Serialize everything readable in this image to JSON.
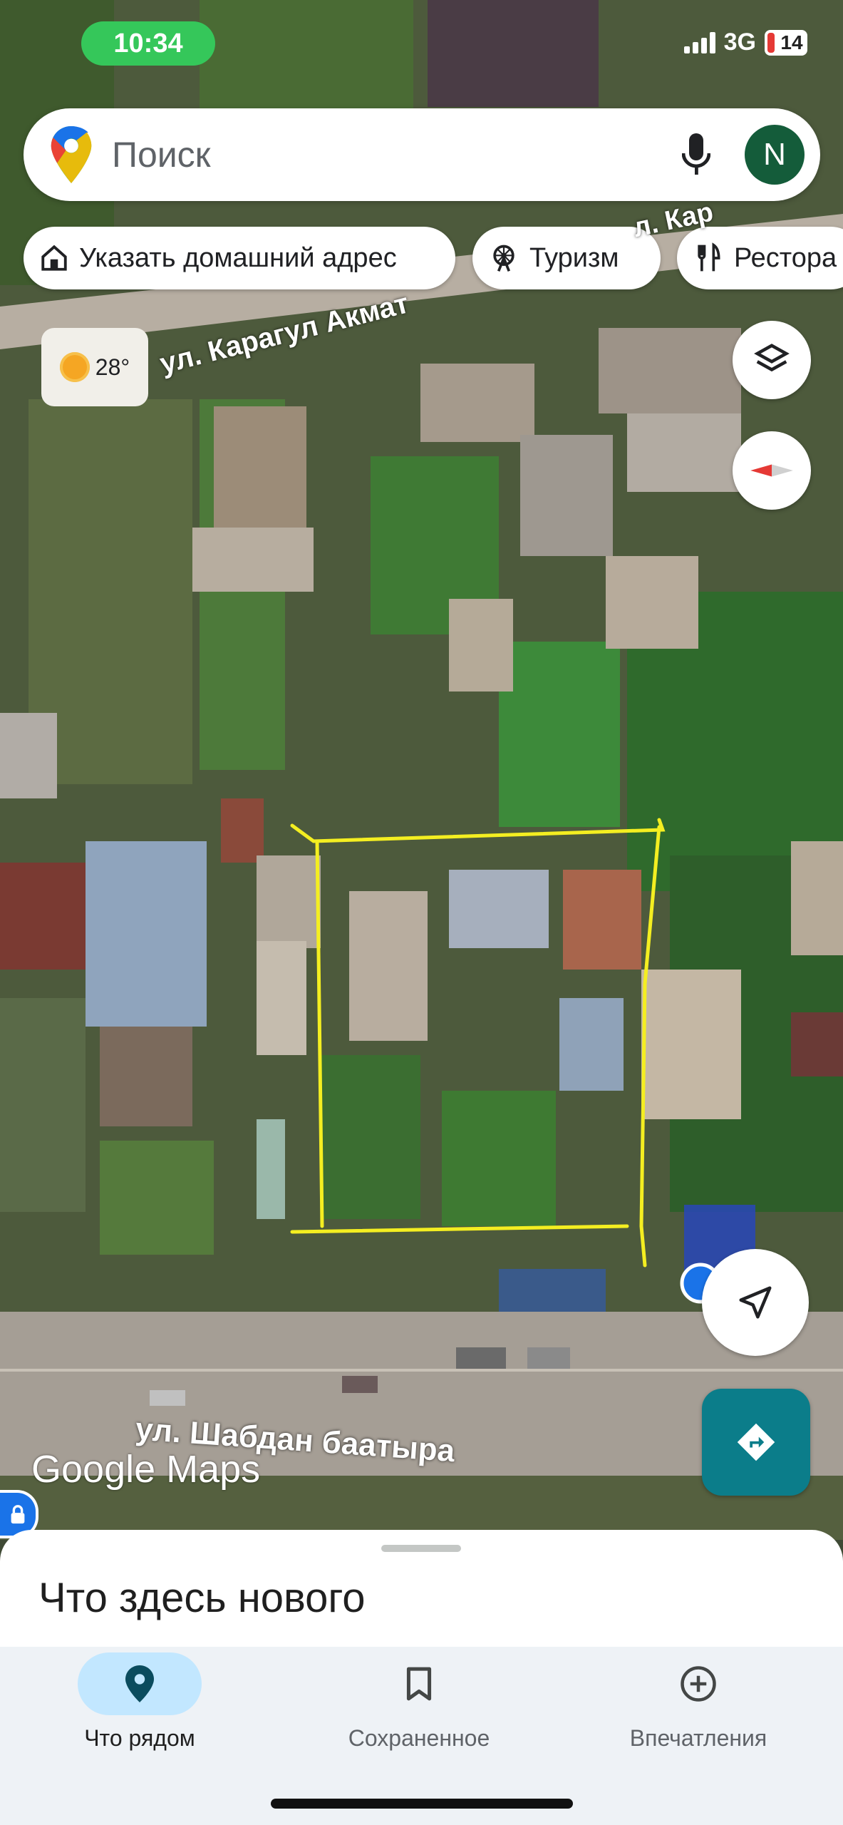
{
  "status_bar": {
    "time": "10:34",
    "network": "3G",
    "battery": "14"
  },
  "search": {
    "placeholder": "Поиск",
    "avatar_letter": "N",
    "logo_icon": "google-maps-pin-icon",
    "mic_icon": "microphone-icon"
  },
  "chips": [
    {
      "label": "Указать домашний адрес",
      "icon": "home-icon"
    },
    {
      "label": "Туризм",
      "icon": "ferris-wheel-icon"
    },
    {
      "label": "Рестора",
      "icon": "fork-knife-icon"
    }
  ],
  "weather": {
    "temperature": "28°",
    "icon": "sun-icon"
  },
  "map": {
    "streets": [
      "ул. Карагул Акмат",
      "ул. Шабдан баатыра",
      "л. Кар"
    ],
    "watermark": "Google Maps",
    "view": "satellite",
    "annotation_color": "#f4ee21"
  },
  "bottom_sheet": {
    "title": "Что здесь нового"
  },
  "bottom_nav": [
    {
      "label": "Что рядом",
      "icon": "location-pin-icon",
      "active": true
    },
    {
      "label": "Сохраненное",
      "icon": "bookmark-icon",
      "active": false
    },
    {
      "label": "Впечатления",
      "icon": "add-circle-icon",
      "active": false
    }
  ],
  "colors": {
    "accent_teal": "#0b7d8a",
    "status_green": "#35c75a",
    "avatar_bg": "#145c3a",
    "active_nav_bg": "#c2e7ff"
  }
}
